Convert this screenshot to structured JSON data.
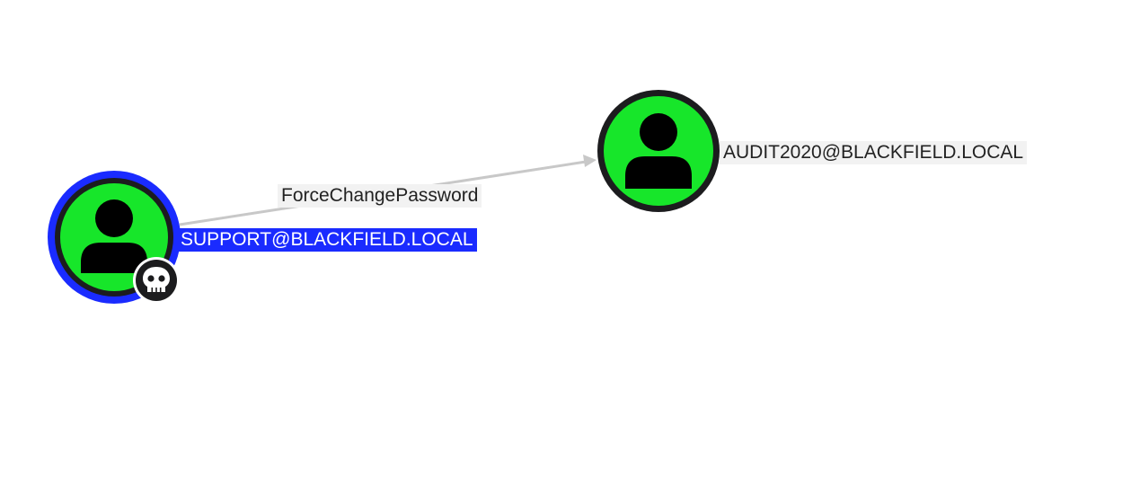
{
  "graph": {
    "edge": {
      "label": "ForceChangePassword",
      "color": "#c8c8c8"
    },
    "nodes": {
      "support": {
        "label": "SUPPORT@BLACKFIELD.LOCAL",
        "type": "user",
        "selected": true,
        "owned": true,
        "badge_icon": "skull-icon",
        "fill_color": "#17e62a",
        "ring_color": "#1a2bff",
        "label_background": "#1a2bff"
      },
      "audit": {
        "label": "AUDIT2020@BLACKFIELD.LOCAL",
        "type": "user",
        "selected": false,
        "owned": false,
        "fill_color": "#17e62a",
        "ring_color": "#1c1c1e",
        "label_background": "#f2f2f2"
      }
    }
  }
}
